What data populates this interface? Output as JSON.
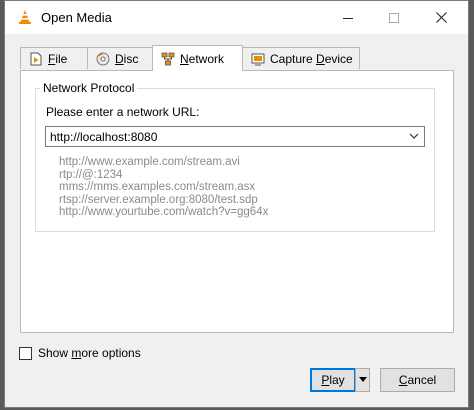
{
  "window": {
    "title": "Open Media"
  },
  "tabs": [
    {
      "label": "File",
      "accel": "F",
      "rest": "ile",
      "icon": "file-play-icon"
    },
    {
      "label": "Disc",
      "accel": "D",
      "rest": "isc",
      "icon": "disc-icon"
    },
    {
      "label": "Network",
      "accel": "N",
      "rest": "etwork",
      "icon": "network-icon"
    },
    {
      "label": "Capture Device",
      "pre": "Capture ",
      "accel": "D",
      "rest": "evice",
      "icon": "capture-device-icon"
    }
  ],
  "network": {
    "group_label": "Network Protocol",
    "url_label": "Please enter a network URL:",
    "url_value": "http://localhost:8080",
    "examples": [
      "http://www.example.com/stream.avi",
      "rtp://@:1234",
      "mms://mms.examples.com/stream.asx",
      "rtsp://server.example.org:8080/test.sdp",
      "http://www.yourtube.com/watch?v=gg64x"
    ]
  },
  "options": {
    "show_more_pre": "Show ",
    "show_more_accel": "m",
    "show_more_rest": "ore options"
  },
  "buttons": {
    "play_accel": "P",
    "play_rest": "lay",
    "cancel_accel": "C",
    "cancel_rest": "ancel"
  },
  "colors": {
    "focus_border": "#0078d7",
    "vlc_orange": "#f08c00"
  }
}
